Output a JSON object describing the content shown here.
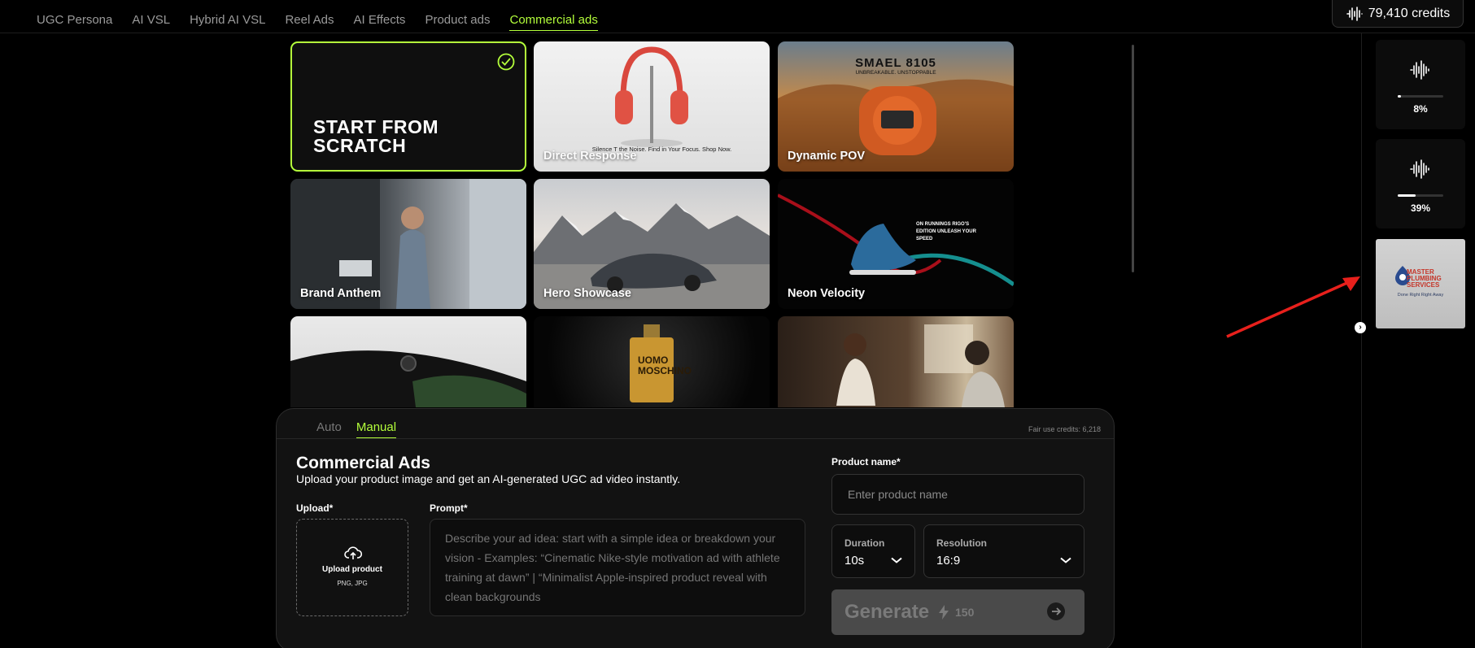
{
  "nav": {
    "tabs": [
      {
        "label": "UGC Persona"
      },
      {
        "label": "AI VSL"
      },
      {
        "label": "Hybrid AI VSL"
      },
      {
        "label": "Reel Ads"
      },
      {
        "label": "AI Effects"
      },
      {
        "label": "Product ads"
      },
      {
        "label": "Commercial ads"
      }
    ],
    "active_tab": "Commercial ads",
    "credits": "79,410 credits"
  },
  "templates": {
    "scratch_label": "START FROM SCRATCH",
    "cards": [
      {
        "label": "Direct Response",
        "overlay_text": "Silence T the Noise. Find in Your Focus. Shop Now."
      },
      {
        "label": "Dynamic POV",
        "overlay_title": "SMAEL 8105",
        "overlay_sub": "UNBREAKABLE. UNSTOPPABLE"
      },
      {
        "label": "Brand Anthem"
      },
      {
        "label": "Hero Showcase"
      },
      {
        "label": "Neon Velocity",
        "overlay_text": "ON RUNNINGS RIGO'S EDITION UNLEASH YOUR SPEED"
      },
      {
        "label": ""
      },
      {
        "label": "",
        "overlay_text": "UOMO MOSCHINO"
      },
      {
        "label": ""
      }
    ]
  },
  "queue": {
    "items": [
      {
        "progress_label": "8%",
        "progress": 0.08
      },
      {
        "progress_label": "39%",
        "progress": 0.39
      }
    ],
    "thumb": {
      "logo_text": "MASTER PLUMBING SERVICES",
      "tagline": "Done Right Right Away"
    }
  },
  "panel": {
    "mode_tabs": [
      "Auto",
      "Manual"
    ],
    "active_mode": "Manual",
    "fair_use": "Fair use credits: 6,218",
    "title": "Commercial Ads",
    "subtitle": "Upload your product image and get an AI-generated UGC ad video instantly.",
    "upload_label": "Upload*",
    "upload_title": "Upload product",
    "upload_formats": "PNG, JPG",
    "prompt_label": "Prompt*",
    "prompt_placeholder": "Describe your ad idea: start with a simple idea or breakdown your vision - Examples: “Cinematic Nike-style motivation ad with athlete training at dawn” | “Minimalist Apple-inspired product reveal with clean backgrounds",
    "product_name_label": "Product name*",
    "product_name_placeholder": "Enter product name",
    "duration_label": "Duration",
    "duration_value": "10s",
    "resolution_label": "Resolution",
    "resolution_value": "16:9",
    "generate_label": "Generate",
    "generate_cost": "150"
  },
  "colors": {
    "accent": "#b4ff3b",
    "annotation_arrow": "#e8201c"
  }
}
